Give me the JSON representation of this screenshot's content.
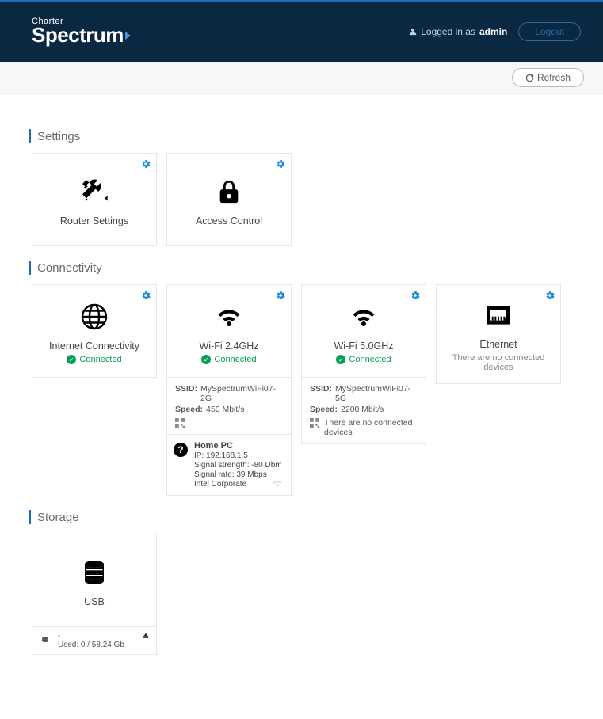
{
  "header": {
    "logo_top": "Charter",
    "logo_main": "Spectrum",
    "logged_in_prefix": "Logged in as",
    "username": "admin",
    "logout": "Logout"
  },
  "subbar": {
    "refresh": "Refresh"
  },
  "sections": {
    "settings": "Settings",
    "connectivity": "Connectivity",
    "storage": "Storage"
  },
  "settings_cards": {
    "router": "Router Settings",
    "access": "Access Control"
  },
  "connectivity": {
    "internet": {
      "title": "Internet Connectivity",
      "status": "Connected"
    },
    "wifi24": {
      "title": "Wi-Fi 2.4GHz",
      "status": "Connected",
      "ssid_label": "SSID:",
      "ssid": "MySpectrumWiFi07-2G",
      "speed_label": "Speed:",
      "speed": "450 Mbit/s",
      "device": {
        "name": "Home PC",
        "ip": "IP: 192.168.1.5",
        "strength": "Signal strength: -80 Dbm",
        "rate": "Signal rate: 39 Mbps",
        "vendor": "Intel Corporate"
      }
    },
    "wifi5": {
      "title": "Wi-Fi 5.0GHz",
      "status": "Connected",
      "ssid_label": "SSID:",
      "ssid": "MySpectrumWiFi07-5G",
      "speed_label": "Speed:",
      "speed": "2200 Mbit/s",
      "no_devices": "There are no connected devices"
    },
    "ethernet": {
      "title": "Ethernet",
      "no_devices": "There are no connected devices"
    }
  },
  "storage": {
    "title": "USB",
    "name": "-",
    "used": "Used: 0 / 58.24 Gb"
  }
}
